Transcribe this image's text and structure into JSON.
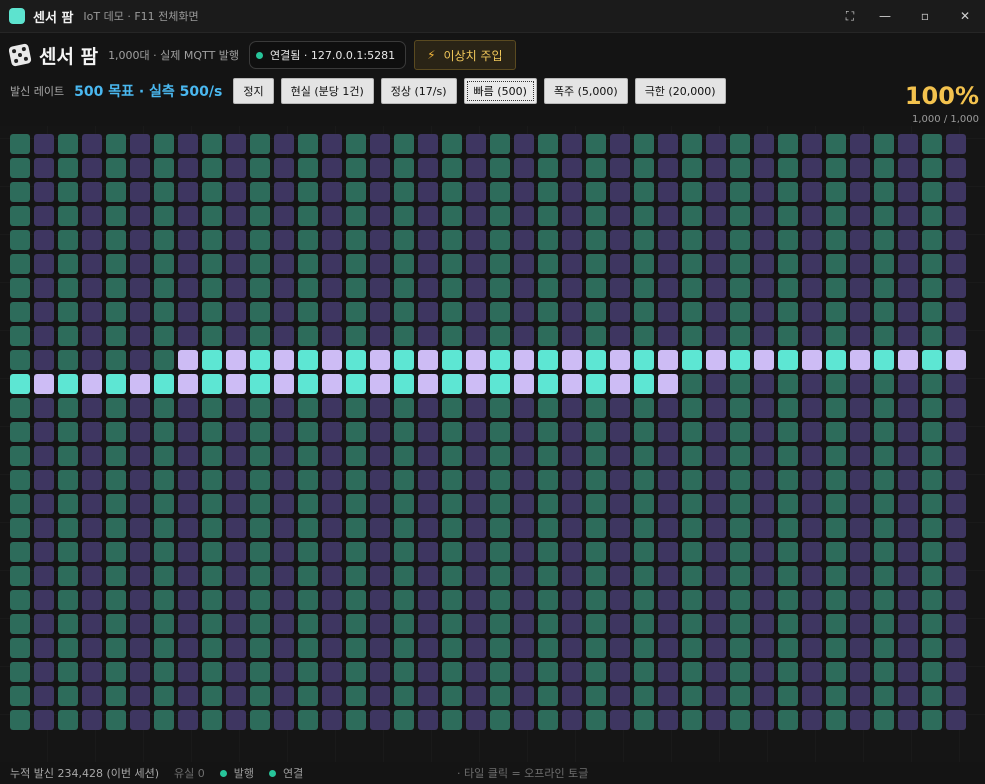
{
  "window": {
    "title": "센서 팜",
    "subtitle": "IoT 데모 · F11 전체화면",
    "controls": {
      "fullscreen": "⛶",
      "minimize": "—",
      "maximize": "▫",
      "close": "✕"
    }
  },
  "header": {
    "title": "센서 팜",
    "subtitle": "1,000대 · 실제 MQTT 발행",
    "connection": {
      "status": "연결됨 · 127.0.0.1:5281",
      "color": "#27c49a"
    },
    "inject_label": "이상치 주입",
    "rate_label": "발신 레이트",
    "rate_value": "500 목표 · 실측 500/s",
    "rate_buttons": [
      {
        "label": "정지",
        "active": false
      },
      {
        "label": "현실 (분당 1건)",
        "active": false
      },
      {
        "label": "정상 (17/s)",
        "active": false
      },
      {
        "label": "빠름 (500)",
        "active": true
      },
      {
        "label": "폭주 (5,000)",
        "active": false
      },
      {
        "label": "극한 (20,000)",
        "active": false
      }
    ],
    "progress_percent": "100%",
    "progress_count": "1,000 / 1,000"
  },
  "grid": {
    "columns": 40,
    "rows": 25,
    "active_row_start": 9,
    "active_col_start": 7,
    "active_row_end": 10,
    "active_col_end": 27,
    "colors": {
      "idle_green": "#2d6c5b",
      "idle_purple": "#3e3661",
      "active_green": "#5de6d3",
      "active_purple": "#cdbcf5"
    }
  },
  "footer": {
    "total": "누적 발신 234,428 (이번 세션)",
    "lost": "유실 0",
    "publish_legend": "발행",
    "connect_legend": "연결",
    "hint": "· 타일 클릭 = 오프라인 토글"
  }
}
